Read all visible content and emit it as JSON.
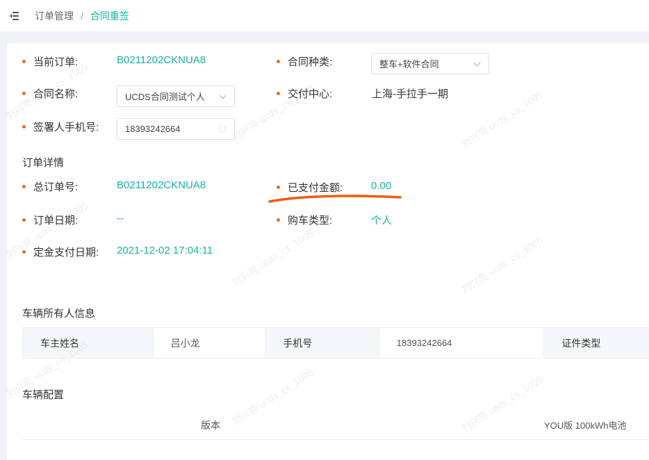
{
  "breadcrumb": {
    "parent": "订单管理",
    "separator": "/",
    "current": "合同重签"
  },
  "form": {
    "current_order": {
      "label": "当前订单:",
      "value": "B0211202CKNUA8"
    },
    "contract_type": {
      "label": "合同种类:",
      "value": "整车+软件合同"
    },
    "contract_name": {
      "label": "合同名称:",
      "value": "UCDS合同测试个人"
    },
    "delivery_center": {
      "label": "交付中心:",
      "value": "上海-手拉手一期"
    },
    "signer_phone": {
      "label": "签署人手机号:",
      "value": "18393242664"
    }
  },
  "order_details": {
    "title": "订单详情",
    "total_order_no": {
      "label": "总订单号:",
      "value": "B0211202CKNUA8"
    },
    "paid_amount": {
      "label": "已支付金额:",
      "value": "0.00"
    },
    "order_date": {
      "label": "订单日期:",
      "value": "--"
    },
    "purchase_type": {
      "label": "购车类型:",
      "value": "个人"
    },
    "deposit_date": {
      "label": "定金支付日期:",
      "value": "2021-12-02 17:04:11"
    }
  },
  "owner_info": {
    "title": "车辆所有人信息",
    "owner_name_label": "车主姓名",
    "owner_name_value": "吕小龙",
    "phone_label": "手机号",
    "phone_value": "18393242664",
    "id_type_label": "证件类型"
  },
  "vehicle_config": {
    "title": "车辆配置",
    "version_label": "版本",
    "version_value": "YOU版 100kWh电池"
  },
  "watermark": "刘兴亮 ucds_cs_1005",
  "colors": {
    "accent": "#15b3a0",
    "bullet": "#f26b1d",
    "annotation": "#f25a12"
  }
}
